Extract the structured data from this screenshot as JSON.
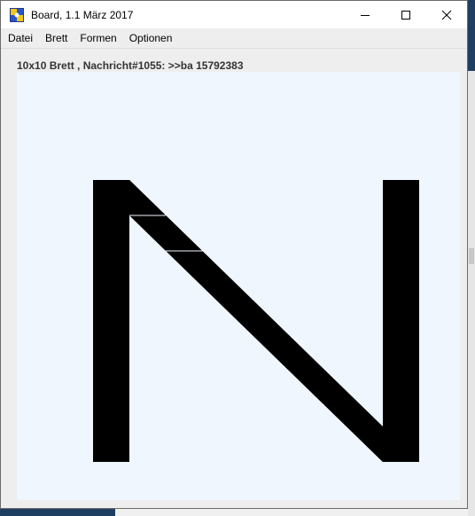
{
  "window": {
    "title": "Board, 1.1 März 2017",
    "controls": {
      "minimize_icon": "minimize-icon",
      "maximize_icon": "maximize-icon",
      "close_icon": "close-icon"
    }
  },
  "menu": {
    "items": [
      {
        "label": "Datei"
      },
      {
        "label": "Brett"
      },
      {
        "label": "Formen"
      },
      {
        "label": "Optionen"
      }
    ]
  },
  "status": {
    "text": "10x10 Brett , Nachricht#1055: >>ba 15792383"
  },
  "board": {
    "background": "#eff6fe",
    "shape_color": "#000000",
    "shape": "N"
  }
}
